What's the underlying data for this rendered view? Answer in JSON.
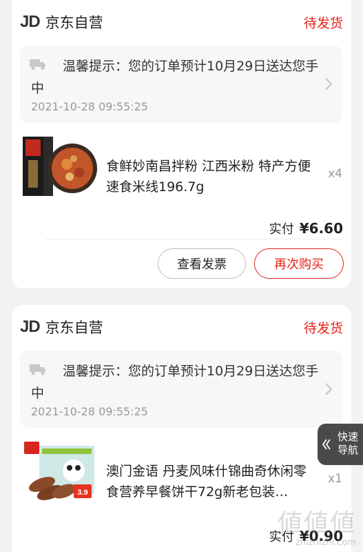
{
  "orders": [
    {
      "shop_logo": "JD",
      "shop_name": "京东自营",
      "status": "待发货",
      "tip_text": "温馨提示：您的订单预计10月29日送达您手中",
      "tip_time": "2021-10-28 09:55:25",
      "product_name": "食鲜妙南昌拌粉 江西米粉 特产方便速食米线196.7g",
      "quantity": "x4",
      "paid_label": "实付",
      "paid_amount": "¥6.60",
      "invoice_button": "查看发票",
      "rebuy_button": "再次购买"
    },
    {
      "shop_logo": "JD",
      "shop_name": "京东自营",
      "status": "待发货",
      "tip_text": "温馨提示：您的订单预计10月29日送达您手中",
      "tip_time": "2021-10-28 09:55:25",
      "product_name": "澳门金语 丹麦风味什锦曲奇休闲零食营养早餐饼干72g新老包装…",
      "quantity": "x1",
      "paid_label": "实付",
      "paid_amount": "¥0.90",
      "thumb_price": "3.9"
    }
  ],
  "quick_nav": {
    "label": "快速导航"
  },
  "watermark": {
    "glyphs": "値値値",
    "url": "zhizhizhi.com"
  },
  "colors": {
    "accent": "#e2231a",
    "background": "#f2f2f2",
    "tip_bg": "#f7f7f7"
  }
}
